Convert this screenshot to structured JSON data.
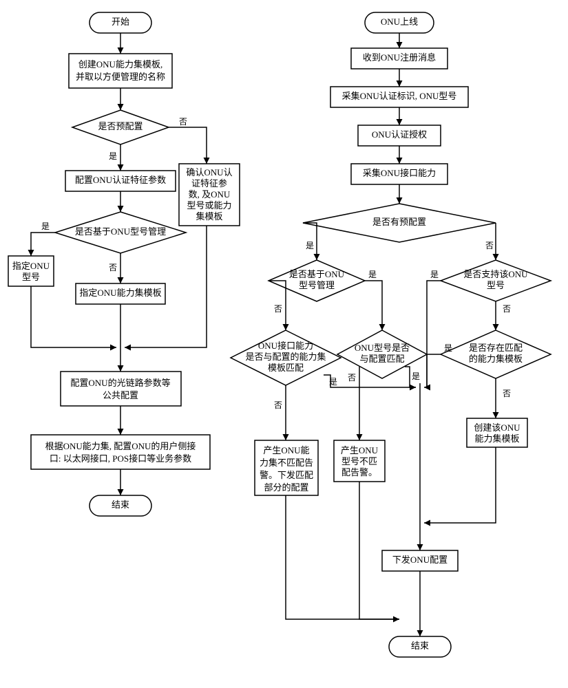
{
  "left": {
    "start": "开始",
    "p1a": "创建ONU能力集模板,",
    "p1b": "并取以方便管理的名称",
    "d1": "是否预配置",
    "p2": "配置ONU认证特征参数",
    "p2alt_a": "确认ONU认",
    "p2alt_b": "证特征参",
    "p2alt_c": "数, 及ONU",
    "p2alt_d": "型号或能力",
    "p2alt_e": "集模板",
    "d2": "是否基于ONU型号管理",
    "p3a": "指定ONU",
    "p3b": "型号",
    "p4": "指定ONU能力集模板",
    "p5a": "配置ONU的光链路参数等",
    "p5b": "公共配置",
    "p6a": "根据ONU能力集, 配置ONU的用户侧接",
    "p6b": "口: 以太网接口, POS接口等业务参数",
    "end": "结束"
  },
  "right": {
    "start": "ONU上线",
    "p1": "收到ONU注册消息",
    "p2": "采集ONU认证标识, ONU型号",
    "p3": "ONU认证授权",
    "p4": "采集ONU接口能力",
    "d1": "是否有预配置",
    "d2a": "是否基于ONU",
    "d2b": "型号管理",
    "d3a": "是否支持该ONU",
    "d3b": "型号",
    "d4a": "ONU接口能力",
    "d4b": "是否与配置的能力集",
    "d4c": "模板匹配",
    "d5a": "ONU型号是否",
    "d5b": "与配置匹配",
    "d6a": "是否存在匹配",
    "d6b": "的能力集模板",
    "p5a": "产生ONU能",
    "p5b": "力集不匹配告",
    "p5c": "警。下发匹配",
    "p5d": "部分的配置",
    "p6a": "产生ONU",
    "p6b": "型号不匹",
    "p6c": "配告警。",
    "p7a": "创建该ONU",
    "p7b": "能力集模板",
    "p8": "下发ONU配置",
    "end": "结束"
  },
  "labels": {
    "yes": "是",
    "no": "否"
  }
}
